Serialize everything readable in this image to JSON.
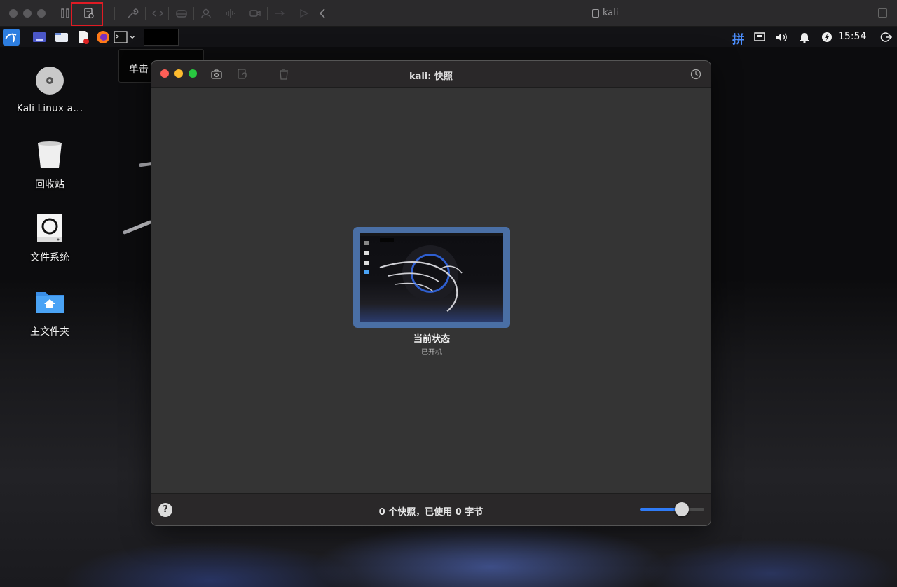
{
  "vm_window": {
    "title": "kali",
    "toolbar_icons": [
      "pause-icon",
      "snapshots-icon",
      "wrench-icon",
      "code-icon",
      "drive-icon",
      "user-icon",
      "audio-icon",
      "camera-icon",
      "usb-icon",
      "share-icon",
      "back-icon"
    ]
  },
  "guest_panel": {
    "ime_label": "拼",
    "clock": "15:54"
  },
  "tooltip": {
    "text": "单击"
  },
  "desktop_icons": [
    {
      "label": "Kali Linux a…",
      "icon": "disc-icon"
    },
    {
      "label": "回收站",
      "icon": "trash-icon"
    },
    {
      "label": "文件系统",
      "icon": "filesystem-icon"
    },
    {
      "label": "主文件夹",
      "icon": "home-folder-icon"
    }
  ],
  "snapshot_dialog": {
    "title": "kali: 快照",
    "snapshot": {
      "name": "当前状态",
      "state": "已开机"
    },
    "footer_text": "0 个快照，已使用 0 字节",
    "help_label": "?",
    "zoom_level": 0.65
  },
  "colors": {
    "highlight": "#e01b24",
    "card": "#4a6fa5",
    "slider_accent": "#2f7bf6",
    "close": "#fe5f57",
    "minimize": "#febc2e",
    "zoom": "#28c840"
  }
}
